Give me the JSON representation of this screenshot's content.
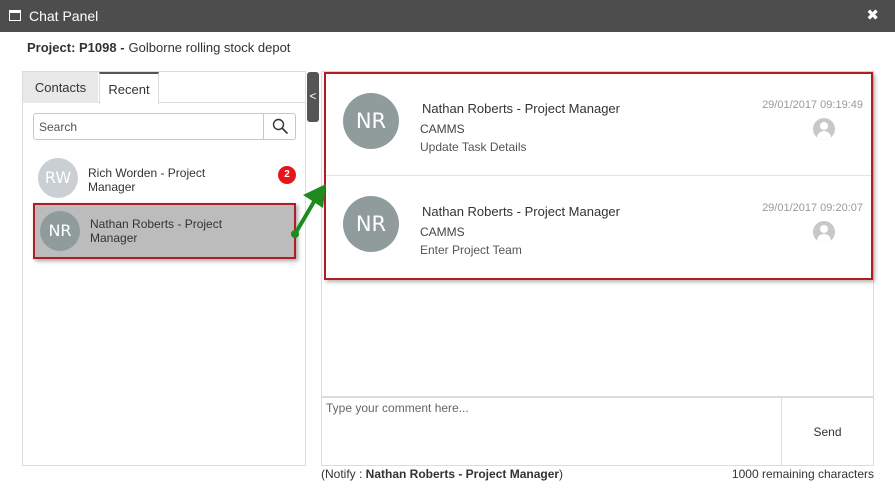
{
  "window": {
    "title": "Chat Panel",
    "close_glyph": "✖",
    "title_icon": "window-icon"
  },
  "project": {
    "label": "Project: P1098 -",
    "name": "Golborne rolling stock depot"
  },
  "tabs": [
    {
      "label": "Contacts",
      "active": false
    },
    {
      "label": "Recent",
      "active": true
    }
  ],
  "search": {
    "placeholder": "Search",
    "icon": "search-icon"
  },
  "contacts": [
    {
      "initials": "RW",
      "name": "Rich Worden - Project Manager",
      "badge": "2",
      "selected": false
    },
    {
      "initials": "NR",
      "name": "Nathan Roberts - Project Manager",
      "badge": "",
      "selected": true
    }
  ],
  "collapse_glyph": "<",
  "messages": [
    {
      "initials": "NR",
      "sender": "Nathan Roberts - Project Manager",
      "org": "CAMMS",
      "text": "Update Task Details",
      "timestamp": "29/01/2017 09:19:49"
    },
    {
      "initials": "NR",
      "sender": "Nathan Roberts - Project Manager",
      "org": "CAMMS",
      "text": "Enter Project Team",
      "timestamp": "29/01/2017 09:20:07"
    }
  ],
  "comment": {
    "placeholder": "Type your comment here..."
  },
  "send_label": "Send",
  "notify": {
    "prefix": "(Notify : ",
    "name": "Nathan Roberts - Project Manager",
    "suffix": ")"
  },
  "remaining": "1000 remaining characters",
  "colors": {
    "titlebar": "#4d4d4d",
    "highlight_border": "#b01e23",
    "badge": "#e8141b",
    "arrow": "#1f8a1f",
    "avatar": "#909b9c"
  }
}
